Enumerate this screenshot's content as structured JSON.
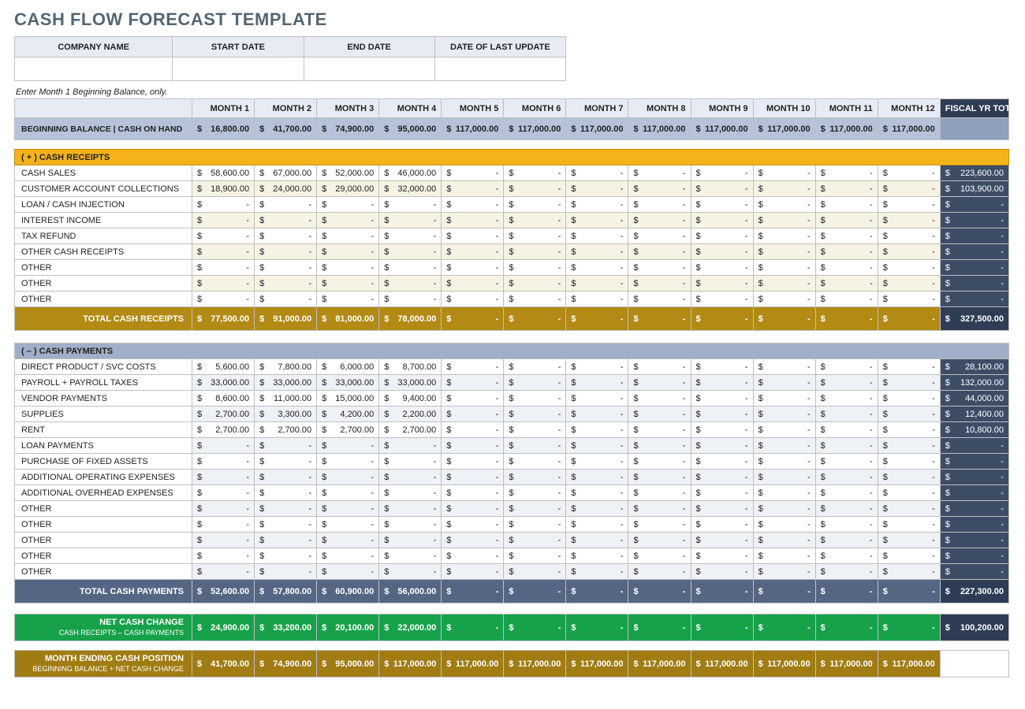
{
  "title": "CASH FLOW FORECAST TEMPLATE",
  "meta_headers": [
    "COMPANY NAME",
    "START DATE",
    "END DATE",
    "DATE OF LAST UPDATE"
  ],
  "meta_values": [
    "",
    "",
    "",
    ""
  ],
  "note": "Enter Month 1 Beginning Balance, only.",
  "month_labels": [
    "MONTH 1",
    "MONTH 2",
    "MONTH 3",
    "MONTH 4",
    "MONTH 5",
    "MONTH 6",
    "MONTH 7",
    "MONTH 8",
    "MONTH 9",
    "MONTH 10",
    "MONTH 11",
    "MONTH 12"
  ],
  "fy_label": "FISCAL YR TOTALS",
  "beginning_label": "BEGINNING BALANCE  |  CASH ON HAND",
  "beginning_values": [
    "16,800.00",
    "41,700.00",
    "74,900.00",
    "95,000.00",
    "117,000.00",
    "117,000.00",
    "117,000.00",
    "117,000.00",
    "117,000.00",
    "117,000.00",
    "117,000.00",
    "117,000.00"
  ],
  "receipts_header": "( + )   CASH RECEIPTS",
  "receipts_rows": [
    {
      "label": "CASH SALES",
      "vals": [
        "58,600.00",
        "67,000.00",
        "52,000.00",
        "46,000.00",
        "-",
        "-",
        "-",
        "-",
        "-",
        "-",
        "-",
        "-"
      ],
      "fy": "223,600.00"
    },
    {
      "label": "CUSTOMER ACCOUNT COLLECTIONS",
      "vals": [
        "18,900.00",
        "24,000.00",
        "29,000.00",
        "32,000.00",
        "-",
        "-",
        "-",
        "-",
        "-",
        "-",
        "-",
        "-"
      ],
      "fy": "103,900.00"
    },
    {
      "label": "LOAN / CASH INJECTION",
      "vals": [
        "-",
        "-",
        "-",
        "-",
        "-",
        "-",
        "-",
        "-",
        "-",
        "-",
        "-",
        "-"
      ],
      "fy": "-"
    },
    {
      "label": "INTEREST INCOME",
      "vals": [
        "-",
        "-",
        "-",
        "-",
        "-",
        "-",
        "-",
        "-",
        "-",
        "-",
        "-",
        "-"
      ],
      "fy": "-"
    },
    {
      "label": "TAX REFUND",
      "vals": [
        "-",
        "-",
        "-",
        "-",
        "-",
        "-",
        "-",
        "-",
        "-",
        "-",
        "-",
        "-"
      ],
      "fy": "-"
    },
    {
      "label": "OTHER CASH RECEIPTS",
      "vals": [
        "-",
        "-",
        "-",
        "-",
        "-",
        "-",
        "-",
        "-",
        "-",
        "-",
        "-",
        "-"
      ],
      "fy": "-"
    },
    {
      "label": "OTHER",
      "vals": [
        "-",
        "-",
        "-",
        "-",
        "-",
        "-",
        "-",
        "-",
        "-",
        "-",
        "-",
        "-"
      ],
      "fy": "-"
    },
    {
      "label": "OTHER",
      "vals": [
        "-",
        "-",
        "-",
        "-",
        "-",
        "-",
        "-",
        "-",
        "-",
        "-",
        "-",
        "-"
      ],
      "fy": "-"
    },
    {
      "label": "OTHER",
      "vals": [
        "-",
        "-",
        "-",
        "-",
        "-",
        "-",
        "-",
        "-",
        "-",
        "-",
        "-",
        "-"
      ],
      "fy": "-"
    }
  ],
  "receipts_total_label": "TOTAL CASH RECEIPTS",
  "receipts_total": [
    "77,500.00",
    "91,000.00",
    "81,000.00",
    "78,000.00",
    "-",
    "-",
    "-",
    "-",
    "-",
    "-",
    "-",
    "-"
  ],
  "receipts_total_fy": "327,500.00",
  "payments_header": "( – )   CASH PAYMENTS",
  "payments_rows": [
    {
      "label": "DIRECT PRODUCT / SVC COSTS",
      "vals": [
        "5,600.00",
        "7,800.00",
        "6,000.00",
        "8,700.00",
        "-",
        "-",
        "-",
        "-",
        "-",
        "-",
        "-",
        "-"
      ],
      "fy": "28,100.00"
    },
    {
      "label": "PAYROLL + PAYROLL TAXES",
      "vals": [
        "33,000.00",
        "33,000.00",
        "33,000.00",
        "33,000.00",
        "-",
        "-",
        "-",
        "-",
        "-",
        "-",
        "-",
        "-"
      ],
      "fy": "132,000.00"
    },
    {
      "label": "VENDOR PAYMENTS",
      "vals": [
        "8,600.00",
        "11,000.00",
        "15,000.00",
        "9,400.00",
        "-",
        "-",
        "-",
        "-",
        "-",
        "-",
        "-",
        "-"
      ],
      "fy": "44,000.00"
    },
    {
      "label": "SUPPLIES",
      "vals": [
        "2,700.00",
        "3,300.00",
        "4,200.00",
        "2,200.00",
        "-",
        "-",
        "-",
        "-",
        "-",
        "-",
        "-",
        "-"
      ],
      "fy": "12,400.00"
    },
    {
      "label": "RENT",
      "vals": [
        "2,700.00",
        "2,700.00",
        "2,700.00",
        "2,700.00",
        "-",
        "-",
        "-",
        "-",
        "-",
        "-",
        "-",
        "-"
      ],
      "fy": "10,800.00"
    },
    {
      "label": "LOAN PAYMENTS",
      "vals": [
        "-",
        "-",
        "-",
        "-",
        "-",
        "-",
        "-",
        "-",
        "-",
        "-",
        "-",
        "-"
      ],
      "fy": "-"
    },
    {
      "label": "PURCHASE OF FIXED ASSETS",
      "vals": [
        "-",
        "-",
        "-",
        "-",
        "-",
        "-",
        "-",
        "-",
        "-",
        "-",
        "-",
        "-"
      ],
      "fy": "-"
    },
    {
      "label": "ADDITIONAL OPERATING EXPENSES",
      "vals": [
        "-",
        "-",
        "-",
        "-",
        "-",
        "-",
        "-",
        "-",
        "-",
        "-",
        "-",
        "-"
      ],
      "fy": "-"
    },
    {
      "label": "ADDITIONAL OVERHEAD EXPENSES",
      "vals": [
        "-",
        "-",
        "-",
        "-",
        "-",
        "-",
        "-",
        "-",
        "-",
        "-",
        "-",
        "-"
      ],
      "fy": "-"
    },
    {
      "label": "OTHER",
      "vals": [
        "-",
        "-",
        "-",
        "-",
        "-",
        "-",
        "-",
        "-",
        "-",
        "-",
        "-",
        "-"
      ],
      "fy": "-"
    },
    {
      "label": "OTHER",
      "vals": [
        "-",
        "-",
        "-",
        "-",
        "-",
        "-",
        "-",
        "-",
        "-",
        "-",
        "-",
        "-"
      ],
      "fy": "-"
    },
    {
      "label": "OTHER",
      "vals": [
        "-",
        "-",
        "-",
        "-",
        "-",
        "-",
        "-",
        "-",
        "-",
        "-",
        "-",
        "-"
      ],
      "fy": "-"
    },
    {
      "label": "OTHER",
      "vals": [
        "-",
        "-",
        "-",
        "-",
        "-",
        "-",
        "-",
        "-",
        "-",
        "-",
        "-",
        "-"
      ],
      "fy": "-"
    },
    {
      "label": "OTHER",
      "vals": [
        "-",
        "-",
        "-",
        "-",
        "-",
        "-",
        "-",
        "-",
        "-",
        "-",
        "-",
        "-"
      ],
      "fy": "-"
    }
  ],
  "payments_total_label": "TOTAL CASH PAYMENTS",
  "payments_total": [
    "52,600.00",
    "57,800.00",
    "60,900.00",
    "56,000.00",
    "-",
    "-",
    "-",
    "-",
    "-",
    "-",
    "-",
    "-"
  ],
  "payments_total_fy": "227,300.00",
  "net_label": "NET CASH CHANGE",
  "net_sub": "CASH RECEIPTS – CASH PAYMENTS",
  "net_values": [
    "24,900.00",
    "33,200.00",
    "20,100.00",
    "22,000.00",
    "-",
    "-",
    "-",
    "-",
    "-",
    "-",
    "-",
    "-"
  ],
  "net_fy": "100,200.00",
  "end_label": "MONTH ENDING CASH POSITION",
  "end_sub": "BEGINNING BALANCE + NET CASH CHANGE",
  "end_values": [
    "41,700.00",
    "74,900.00",
    "95,000.00",
    "117,000.00",
    "117,000.00",
    "117,000.00",
    "117,000.00",
    "117,000.00",
    "117,000.00",
    "117,000.00",
    "117,000.00",
    "117,000.00"
  ]
}
